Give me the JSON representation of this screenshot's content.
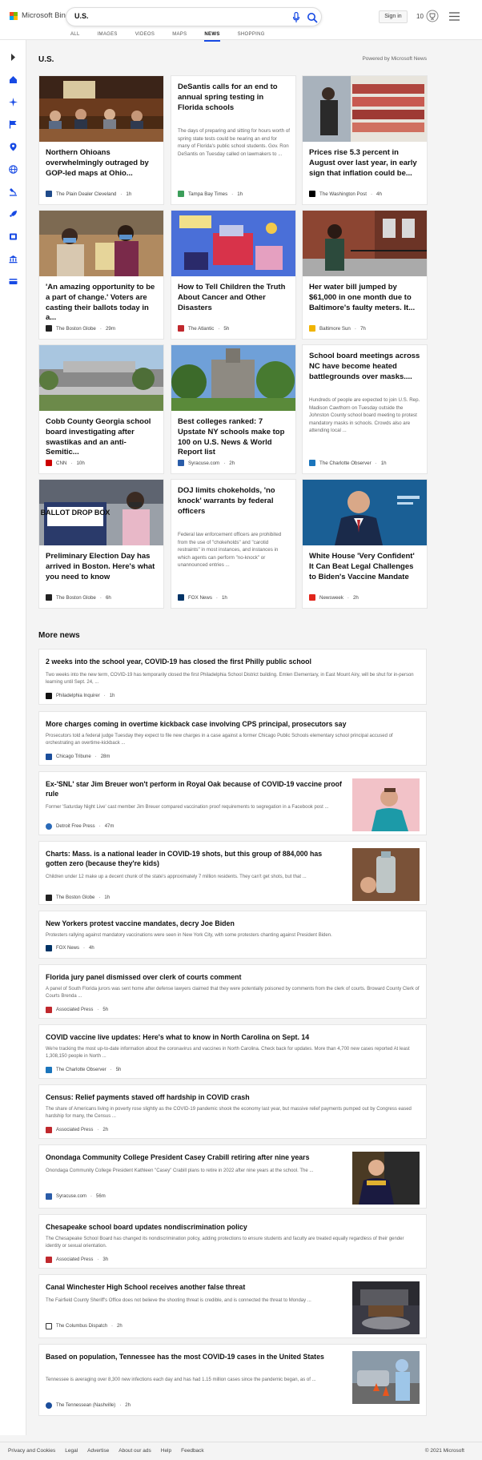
{
  "header": {
    "logo_text": "Microsoft Bing",
    "search_value": "U.S.",
    "sign_in": "Sign in",
    "rewards_count": "10",
    "tabs": [
      "ALL",
      "IMAGES",
      "VIDEOS",
      "MAPS",
      "NEWS",
      "SHOPPING"
    ],
    "active_tab": "NEWS"
  },
  "section": {
    "title": "U.S.",
    "powered_by": "Powered by Microsoft News"
  },
  "cards": [
    {
      "title": "Northern Ohioans overwhelmingly outraged by GOP-led maps at Ohio...",
      "desc": "",
      "source": "The Plain Dealer Cleveland",
      "time": "1h"
    },
    {
      "title": "DeSantis calls for an end to annual spring testing in Florida schools",
      "desc": "The days of preparing and sitting for hours worth of spring state tests could be nearing an end for many of Florida's public school students. Gov. Ron DeSantis on Tuesday called on lawmakers to ...",
      "source": "Tampa Bay Times",
      "time": "1h"
    },
    {
      "title": "Prices rise 5.3 percent in August over last year, in early sign that inflation could be...",
      "desc": "",
      "source": "The Washington Post",
      "time": "4h"
    },
    {
      "title": "'An amazing opportunity to be a part of change.' Voters are casting their ballots today in a...",
      "desc": "",
      "source": "The Boston Globe",
      "time": "29m"
    },
    {
      "title": "How to Tell Children the Truth About Cancer and Other Disasters",
      "desc": "",
      "source": "The Atlantic",
      "time": "5h"
    },
    {
      "title": "Her water bill jumped by $61,000 in one month due to Baltimore's faulty meters. It...",
      "desc": "",
      "source": "Baltimore Sun",
      "time": "7h"
    },
    {
      "title": "Cobb County Georgia school board investigating after swastikas and an anti-Semitic...",
      "desc": "",
      "source": "CNN",
      "time": "10h"
    },
    {
      "title": "Best colleges ranked: 7 Upstate NY schools make top 100 on U.S. News & World Report list",
      "desc": "",
      "source": "Syracuse.com",
      "time": "2h"
    },
    {
      "title": "School board meetings across NC have become heated battlegrounds over masks....",
      "desc": "Hundreds of people are expected to join U.S. Rep. Madison Cawthorn on Tuesday outside the Johnston County school board meeting to protest mandatory masks in schools. Crowds also are attending local ...",
      "source": "The Charlotte Observer",
      "time": "1h"
    },
    {
      "title": "Preliminary Election Day has arrived in Boston. Here's what you need to know",
      "desc": "",
      "source": "The Boston Globe",
      "time": "6h"
    },
    {
      "title": "DOJ limits chokeholds, 'no knock' warrants by federal officers",
      "desc": "Federal law enforcement officers are prohibited from the use of \"chokeholds\" and \"carotid restraints\" in most instances, and instances in which agents can perform \"no-knock\" or unannounced entries ...",
      "source": "FOX News",
      "time": "1h"
    },
    {
      "title": "White House 'Very Confident' It Can Beat Legal Challenges to Biden's Vaccine Mandate",
      "desc": "",
      "source": "Newsweek",
      "time": "2h"
    }
  ],
  "ballot_sign": "BALLOT DROP BOX",
  "more_news_title": "More news",
  "more_news": [
    {
      "title": "2 weeks into the school year, COVID-19 has closed the first Philly public school",
      "desc": "Two weeks into the new term, COVID-19 has temporarily closed the first Philadelphia School District building. Emlen Elementary, in East Mount Airy, will be shut for in-person learning until Sept. 24, ...",
      "source": "Philadelphia Inquirer",
      "time": "1h"
    },
    {
      "title": "More charges coming in overtime kickback case involving CPS principal, prosecutors say",
      "desc": "Prosecutors told a federal judge Tuesday they expect to file new charges in a case against a former Chicago Public Schools elementary school principal accused of orchestrating an overtime-kickback ...",
      "source": "Chicago Tribune",
      "time": "28m"
    },
    {
      "title": "Ex-'SNL' star Jim Breuer won't perform in Royal Oak because of COVID-19 vaccine proof rule",
      "desc": "Former 'Saturday Night Live' cast member Jim Breuer compared vaccination proof requirements to segregation in a Facebook post ...",
      "source": "Detroit Free Press",
      "time": "47m"
    },
    {
      "title": "Charts: Mass. is a national leader in COVID-19 shots, but this group of 884,000 has gotten zero (because they're kids)",
      "desc": "Children under 12 make up a decent chunk of the state's approximately 7 million residents. They can't get shots, but that ...",
      "source": "The Boston Globe",
      "time": "1h"
    },
    {
      "title": "New Yorkers protest vaccine mandates, decry Joe Biden",
      "desc": "Protesters rallying against mandatory vaccinations were seen in New York City, with some protesters chanting against President Biden.",
      "source": "FOX News",
      "time": "4h"
    },
    {
      "title": "Florida jury panel dismissed over clerk of courts comment",
      "desc": "A panel of South Florida jurors was sent home after defense lawyers claimed that they were potentially poisoned by comments from the clerk of courts. Broward County Clerk of Courts Brenda ...",
      "source": "Associated Press",
      "time": "5h"
    },
    {
      "title": "COVID vaccine live updates: Here's what to know in North Carolina on Sept. 14",
      "desc": "We're tracking the most up-to-date information about the coronavirus and vaccines in North Carolina. Check back for updates. More than 4,700 new cases reported At least 1,308,150 people in North ...",
      "source": "The Charlotte Observer",
      "time": "5h"
    },
    {
      "title": "Census: Relief payments staved off hardship in COVID crash",
      "desc": "The share of Americans living in poverty rose slightly as the COVID-19 pandemic shook the economy last year, but massive relief payments pumped out by Congress eased hardship for many, the Census ...",
      "source": "Associated Press",
      "time": "2h"
    },
    {
      "title": "Onondaga Community College President Casey Crabill retiring after nine years",
      "desc": "Onondaga Community College President Kathleen \"Casey\" Crabill plans to retire in 2022 after nine years at the school. The ...",
      "source": "Syracuse.com",
      "time": "56m"
    },
    {
      "title": "Chesapeake school board updates nondiscrimination policy",
      "desc": "The Chesapeake School Board has changed its nondiscrimination policy, adding protections to ensure students and faculty are treated equally regardless of their gender identity or sexual orientation.",
      "source": "Associated Press",
      "time": "3h"
    },
    {
      "title": "Canal Winchester High School receives another false threat",
      "desc": "The Fairfield County Sheriff's Office does not believe the shooting threat is credible, and is connected the threat to Monday ...",
      "source": "The Columbus Dispatch",
      "time": "2h"
    },
    {
      "title": "Based on population, Tennessee has the most COVID-19 cases in the United States",
      "desc": "Tennessee is averaging over 8,300 new infections each day and has had 1.15 million cases since the pandemic began, as of ...",
      "source": "The Tennessean (Nashville)",
      "time": "2h"
    }
  ],
  "footer": {
    "links": [
      "Privacy and Cookies",
      "Legal",
      "Advertise",
      "About our ads",
      "Help",
      "Feedback"
    ],
    "copyright": "© 2021 Microsoft"
  },
  "colors": {
    "accent": "#174ae4",
    "logo": [
      "#f25022",
      "#7fba00",
      "#00a4ef",
      "#ffb900"
    ],
    "sidebar_icon": "#174ae4"
  },
  "sidebar_icons": [
    "chevron-right-icon",
    "home-icon",
    "sparkle-icon",
    "flag-icon",
    "location-icon",
    "globe-icon",
    "microscope-icon",
    "rocket-icon",
    "film-icon",
    "bank-icon",
    "credit-card-icon"
  ]
}
